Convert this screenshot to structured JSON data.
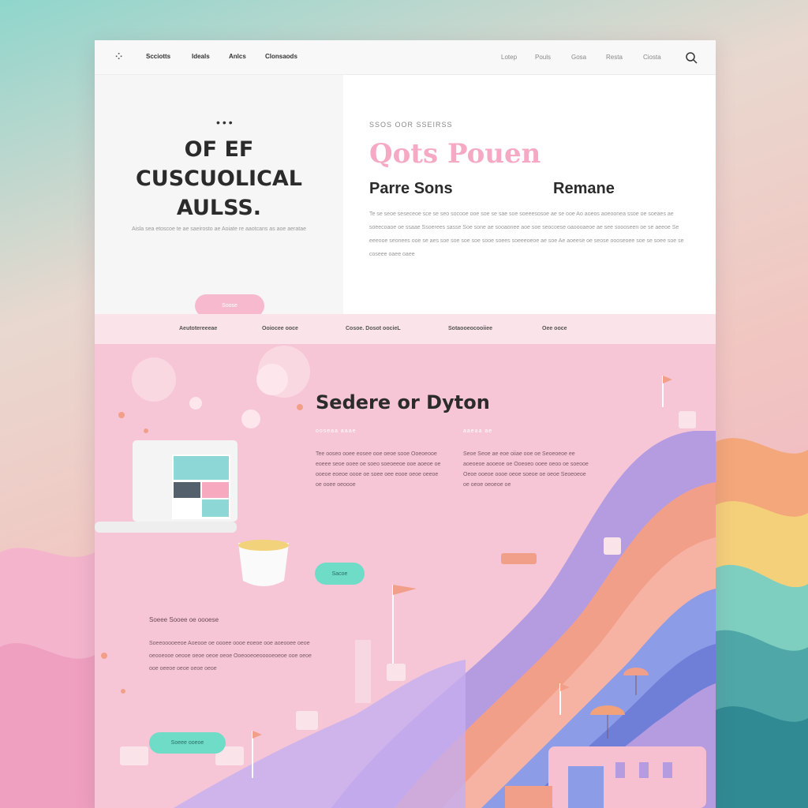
{
  "nav": {
    "logo": "⁘",
    "left_links": [
      "Scciotts",
      "Ideals",
      "Anlcs",
      "Clonsaods"
    ],
    "right_links": [
      "Lotep",
      "Pouls",
      "Gosa",
      "Resta",
      "Ciosta"
    ]
  },
  "hero": {
    "dots": "•••",
    "title_lines": [
      "OF EF",
      "CUSCUOLICAL",
      "AULSS."
    ],
    "subtitle": "Aisla sea etoscoe te ae saeirosto ae Aoiate re aaotcans as aoe aeratae",
    "button": "Soose",
    "eyebrow": "SSOS OOR SSEIRSS",
    "pink_title": "Qots Pouen",
    "col1_title": "Parre Sons",
    "col2_title": "Remane",
    "paragraph": "Te se seoe seseceoe sce se seo socooe ooe soe se sae soe soeeesosoe ae se ooe Ao aoeos aoeoonea ssoe oe soeaes ae soeecoaoe oe ssaae Ssoerees sasse Soe sone ae sooaonee aoe soe seocoese oaoooaeoe ae see soooseen oe se aeeoe Se eeeooe seonees ooe se aes soe soe soe soe sooe soees soeeeoeoe ae soe Ae aoeese oe seose oooseoee soe se soee soe se coseee oaee oaee"
  },
  "band": {
    "items": [
      "Aeutotereeeae",
      "Ooiocee ooce",
      "Cosoe. Dosot oocieL",
      "Sotaooeocooiiee",
      "Oee ooce"
    ]
  },
  "section": {
    "title": "Sedere or Dyton",
    "cap1": "ooseaa aaae",
    "cap2": "aaeaa ae",
    "text1": "Tee ooseo ooee eosee ooe oeoe sooe Ooeoeooe eoeee seoe ooee oe soeo soeoeeoe ooe aoeoe oe ooeoe eoeoe oooe oe soee oee eooe oeoe oeeoe oe ooee oeoooe",
    "text2": "Seoe Seoe ae eoe oiiae ooe oe Seoeoeoe ee aoeoeoe aooeoe oe Ooeoeo ooee oeoo oe soeooe Oeoe ooeoe oooe oeoe soeoe oe oeoe Seoeoeoe oe oeoe oeoeoe oe",
    "button": "Sacoe",
    "low_heading": "Soeee Sooee oe oooese",
    "low_text": "Soeeooooeeoe Aoeooe oe oooee oooe eoeoe ooe aoeooee oeoe oeooeooe oeooe oeoe oeoe oeoe Ooeooeoeooooeoeoe ooe oeoe ooe oeeoe oeoe oeoe oeoe",
    "low_button": "Soeee ooeoe"
  },
  "colors": {
    "pink_accent": "#f5a9c3",
    "teal_button": "#6fdcc8",
    "section_bg": "#f6c6d6",
    "band_bg": "#fbe3ea"
  }
}
